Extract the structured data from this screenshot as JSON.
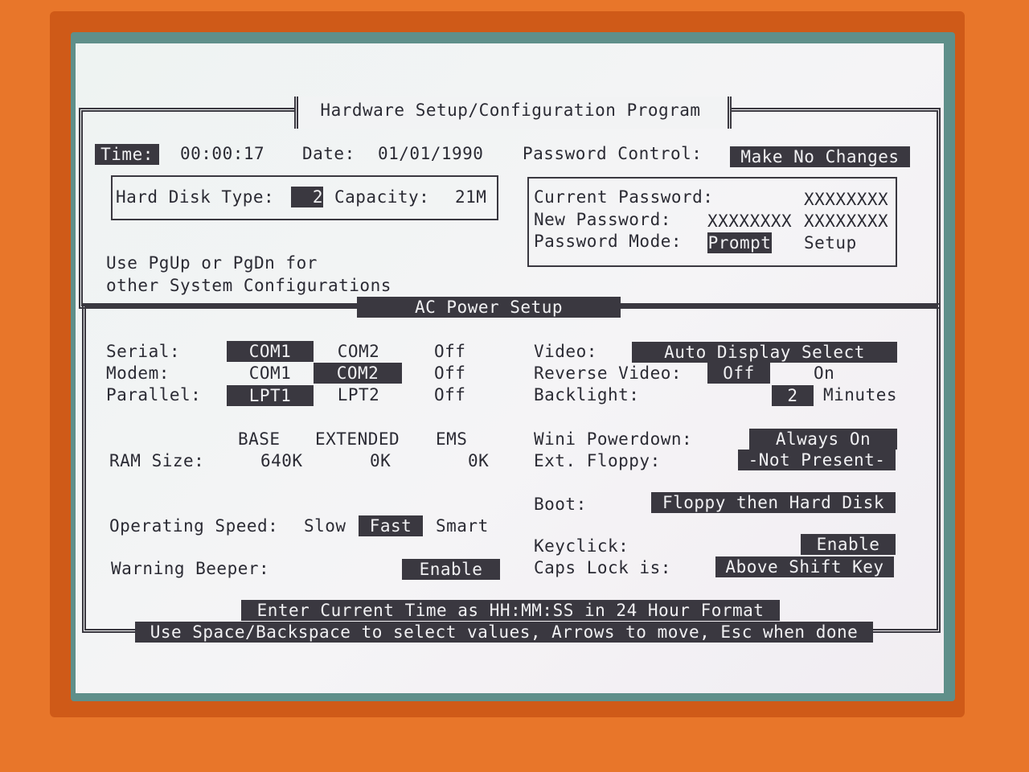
{
  "title": "Hardware Setup/Configuration Program",
  "time_label": "Time:",
  "time_value": "00:00:17",
  "date_label": "Date:",
  "date_value": "01/01/1990",
  "password_control": {
    "label": "Password Control:",
    "value": "Make No Changes"
  },
  "hard_disk": {
    "type_label": "Hard Disk Type:",
    "type_value": "2",
    "capacity_label": "Capacity:",
    "capacity_value": "21M"
  },
  "passwords": {
    "current_label": "Current Password:",
    "current_value": "XXXXXXXX",
    "new_label": "New Password:",
    "new_value_1": "XXXXXXXX",
    "new_value_2": "XXXXXXXX",
    "mode_label": "Password Mode:",
    "mode_prompt": "Prompt",
    "mode_setup": "Setup"
  },
  "pg_hint_line1": "Use PgUp or PgDn for",
  "pg_hint_line2": "other System Configurations",
  "section_title": "AC Power Setup",
  "serial": {
    "label": "Serial:",
    "opt1": "COM1",
    "opt2": "COM2",
    "opt3": "Off",
    "selected": "COM1"
  },
  "modem": {
    "label": "Modem:",
    "opt1": "COM1",
    "opt2": "COM2",
    "opt3": "Off",
    "selected": "COM2"
  },
  "parallel": {
    "label": "Parallel:",
    "opt1": "LPT1",
    "opt2": "LPT2",
    "opt3": "Off",
    "selected": "LPT1"
  },
  "ram": {
    "label": "RAM Size:",
    "base_header": "BASE",
    "extended_header": "EXTENDED",
    "ems_header": "EMS",
    "base": "640K",
    "extended": "0K",
    "ems": "0K"
  },
  "speed": {
    "label": "Operating Speed:",
    "slow": "Slow",
    "fast": "Fast",
    "smart": "Smart",
    "selected": "Fast"
  },
  "beeper": {
    "label": "Warning Beeper:",
    "value": "Enable"
  },
  "video": {
    "label": "Video:",
    "value": "Auto Display Select"
  },
  "reverse_video": {
    "label": "Reverse Video:",
    "off": "Off",
    "on": "On",
    "selected": "Off"
  },
  "backlight": {
    "label": "Backlight:",
    "value": "2",
    "unit": "Minutes"
  },
  "wini": {
    "label": "Wini Powerdown:",
    "value": "Always On"
  },
  "ext_floppy": {
    "label": "Ext. Floppy:",
    "value": "-Not Present-"
  },
  "boot": {
    "label": "Boot:",
    "value": "Floppy then Hard Disk"
  },
  "keyclick": {
    "label": "Keyclick:",
    "value": "Enable"
  },
  "caps_lock": {
    "label": "Caps Lock is:",
    "value": "Above Shift Key"
  },
  "status_line1": "Enter Current Time as HH:MM:SS in 24 Hour Format",
  "status_line2": "Use Space/Backspace to select values, Arrows to move, Esc when done",
  "colors": {
    "case": "#e8762a",
    "lcd_bg": "#f2f3f4",
    "lcd_fg": "#2b2b34",
    "highlight": "#3a3840"
  }
}
